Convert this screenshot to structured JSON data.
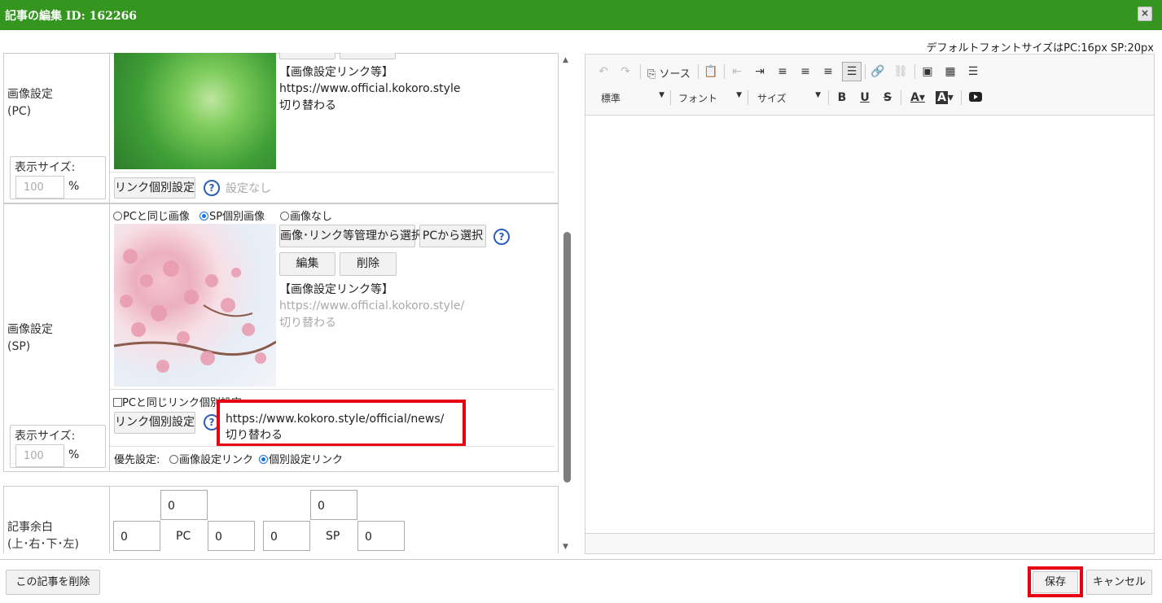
{
  "titlebar": {
    "title": "記事の編集 ID: 162266",
    "close_icon": "×"
  },
  "font_note": "デフォルトフォントサイズはPC:16px SP:20px",
  "pc_image": {
    "label_line1": "画像設定",
    "label_line2": "(PC)",
    "link_heading": "【画像設定リンク等】",
    "link_url": "https://www.official.kokoro.style",
    "link_switch": "切り替わる",
    "size_label": "表示サイズ:",
    "size_value": "100",
    "size_unit": "%",
    "link_button": "リンク個別設定",
    "link_status": "設定なし"
  },
  "sp_image": {
    "label_line1": "画像設定",
    "label_line2": "(SP)",
    "radio_same_pc": "PCと同じ画像",
    "radio_sp_individual": "SP個別画像",
    "radio_no_image": "画像なし",
    "select_from_manager": "画像･リンク等管理から選択",
    "select_from_pc": "PCから選択",
    "edit_button": "編集",
    "delete_button": "削除",
    "link_heading": "【画像設定リンク等】",
    "link_url": "https://www.official.kokoro.style/",
    "link_switch": "切り替わる",
    "same_link_checkbox": "PCと同じリンク個別設定",
    "link_button": "リンク個別設定",
    "individual_url": "https://www.kokoro.style/official/news/",
    "individual_switch": "切り替わる",
    "size_label": "表示サイズ:",
    "size_value": "100",
    "size_unit": "%",
    "priority_label": "優先設定:",
    "priority_image_link": "画像設定リンク",
    "priority_individual_link": "個別設定リンク"
  },
  "margin": {
    "label_line1": "記事余白",
    "label_line2": "(上･右･下･左)",
    "pc_label": "PC",
    "sp_label": "SP",
    "pc_top": "0",
    "pc_right": "0",
    "pc_left": "0",
    "sp_top": "0",
    "sp_right": "0",
    "sp_left": "0"
  },
  "toolbar": {
    "source_label": "ソース",
    "format_select": "標準",
    "font_select": "フォント",
    "size_select": "サイズ"
  },
  "footer": {
    "delete_article": "この記事を削除",
    "save": "保存",
    "cancel": "キャンセル"
  },
  "colors": {
    "titlebar": "#34961f",
    "highlight": "#e60012",
    "help_icon": "#2b5fb9"
  }
}
